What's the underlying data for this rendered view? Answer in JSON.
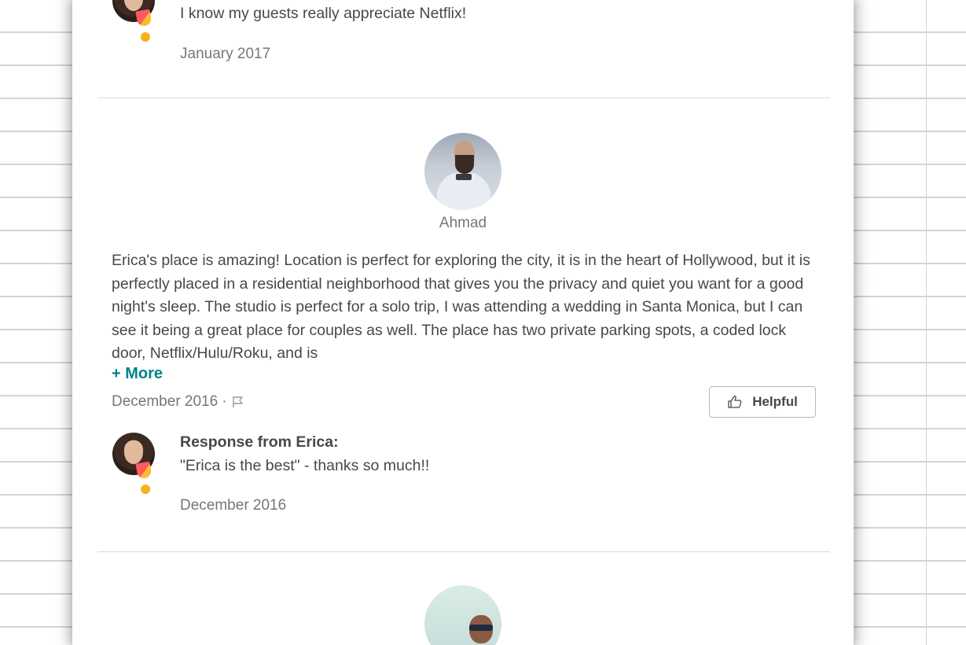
{
  "review_prev": {
    "response_text": "I know my guests really appreciate Netflix!",
    "response_date": "January 2017"
  },
  "review": {
    "reviewer_name": "Ahmad",
    "body": "Erica's place is amazing! Location is perfect for exploring the city, it is in the heart of Hollywood, but it is perfectly placed in a residential neighborhood that gives you the privacy and quiet you want for a good night's sleep. The studio is perfect for a solo trip, I was attending a wedding in Santa Monica, but I can see it being a great place for couples as well. The place has two private parking spots, a coded lock door, Netflix/Hulu/Roku, and is",
    "more_label": "+ More",
    "date": "December 2016",
    "separator": "·",
    "helpful_label": "Helpful",
    "response": {
      "title": "Response from Erica:",
      "text": "\"Erica is the best\" - thanks so much!!",
      "date": "December 2016"
    }
  },
  "icons": {
    "flag": "flag-icon",
    "thumbs_up": "thumbs-up-icon",
    "superhost_badge": "superhost-badge-icon"
  },
  "colors": {
    "link": "#008489",
    "text": "#484848",
    "muted": "#767676",
    "badge_red": "#ff5a5f",
    "badge_yellow": "#fdbb30"
  }
}
